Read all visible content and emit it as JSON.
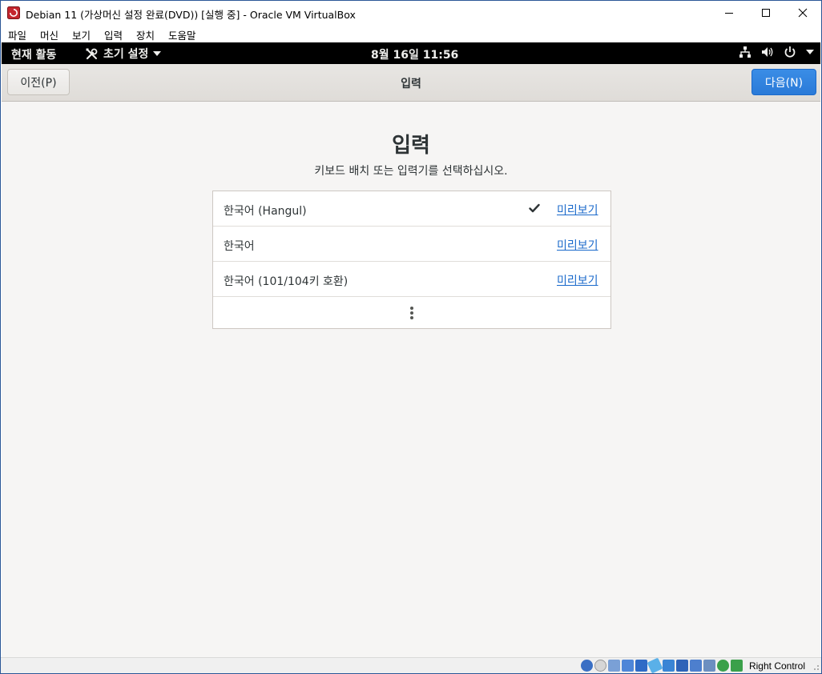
{
  "window": {
    "title": "Debian 11 (가상머신 설정 완료(DVD)) [실행 중] - Oracle VM VirtualBox"
  },
  "menubar": [
    "파일",
    "머신",
    "보기",
    "입력",
    "장치",
    "도움말"
  ],
  "gnome": {
    "activities": "현재 활동",
    "app_menu": "초기 설정",
    "clock": "8월 16일  11:56"
  },
  "header": {
    "prev_label": "이전(P)",
    "title": "입력",
    "next_label": "다음(N)"
  },
  "main": {
    "heading": "입력",
    "subtitle": "키보드 배치 또는 입력기를 선택하십시오.",
    "rows": [
      {
        "label": "한국어 (Hangul)",
        "selected": true,
        "link": "미리보기"
      },
      {
        "label": "한국어",
        "selected": false,
        "link": "미리보기"
      },
      {
        "label": "한국어 (101/104키 호환)",
        "selected": false,
        "link": "미리보기"
      }
    ]
  },
  "statusbar": {
    "host_key": "Right Control"
  },
  "colors": {
    "accent": "#2a7ad8",
    "link": "#1b6acb",
    "topbar": "#000000",
    "background": "#f6f5f4"
  }
}
